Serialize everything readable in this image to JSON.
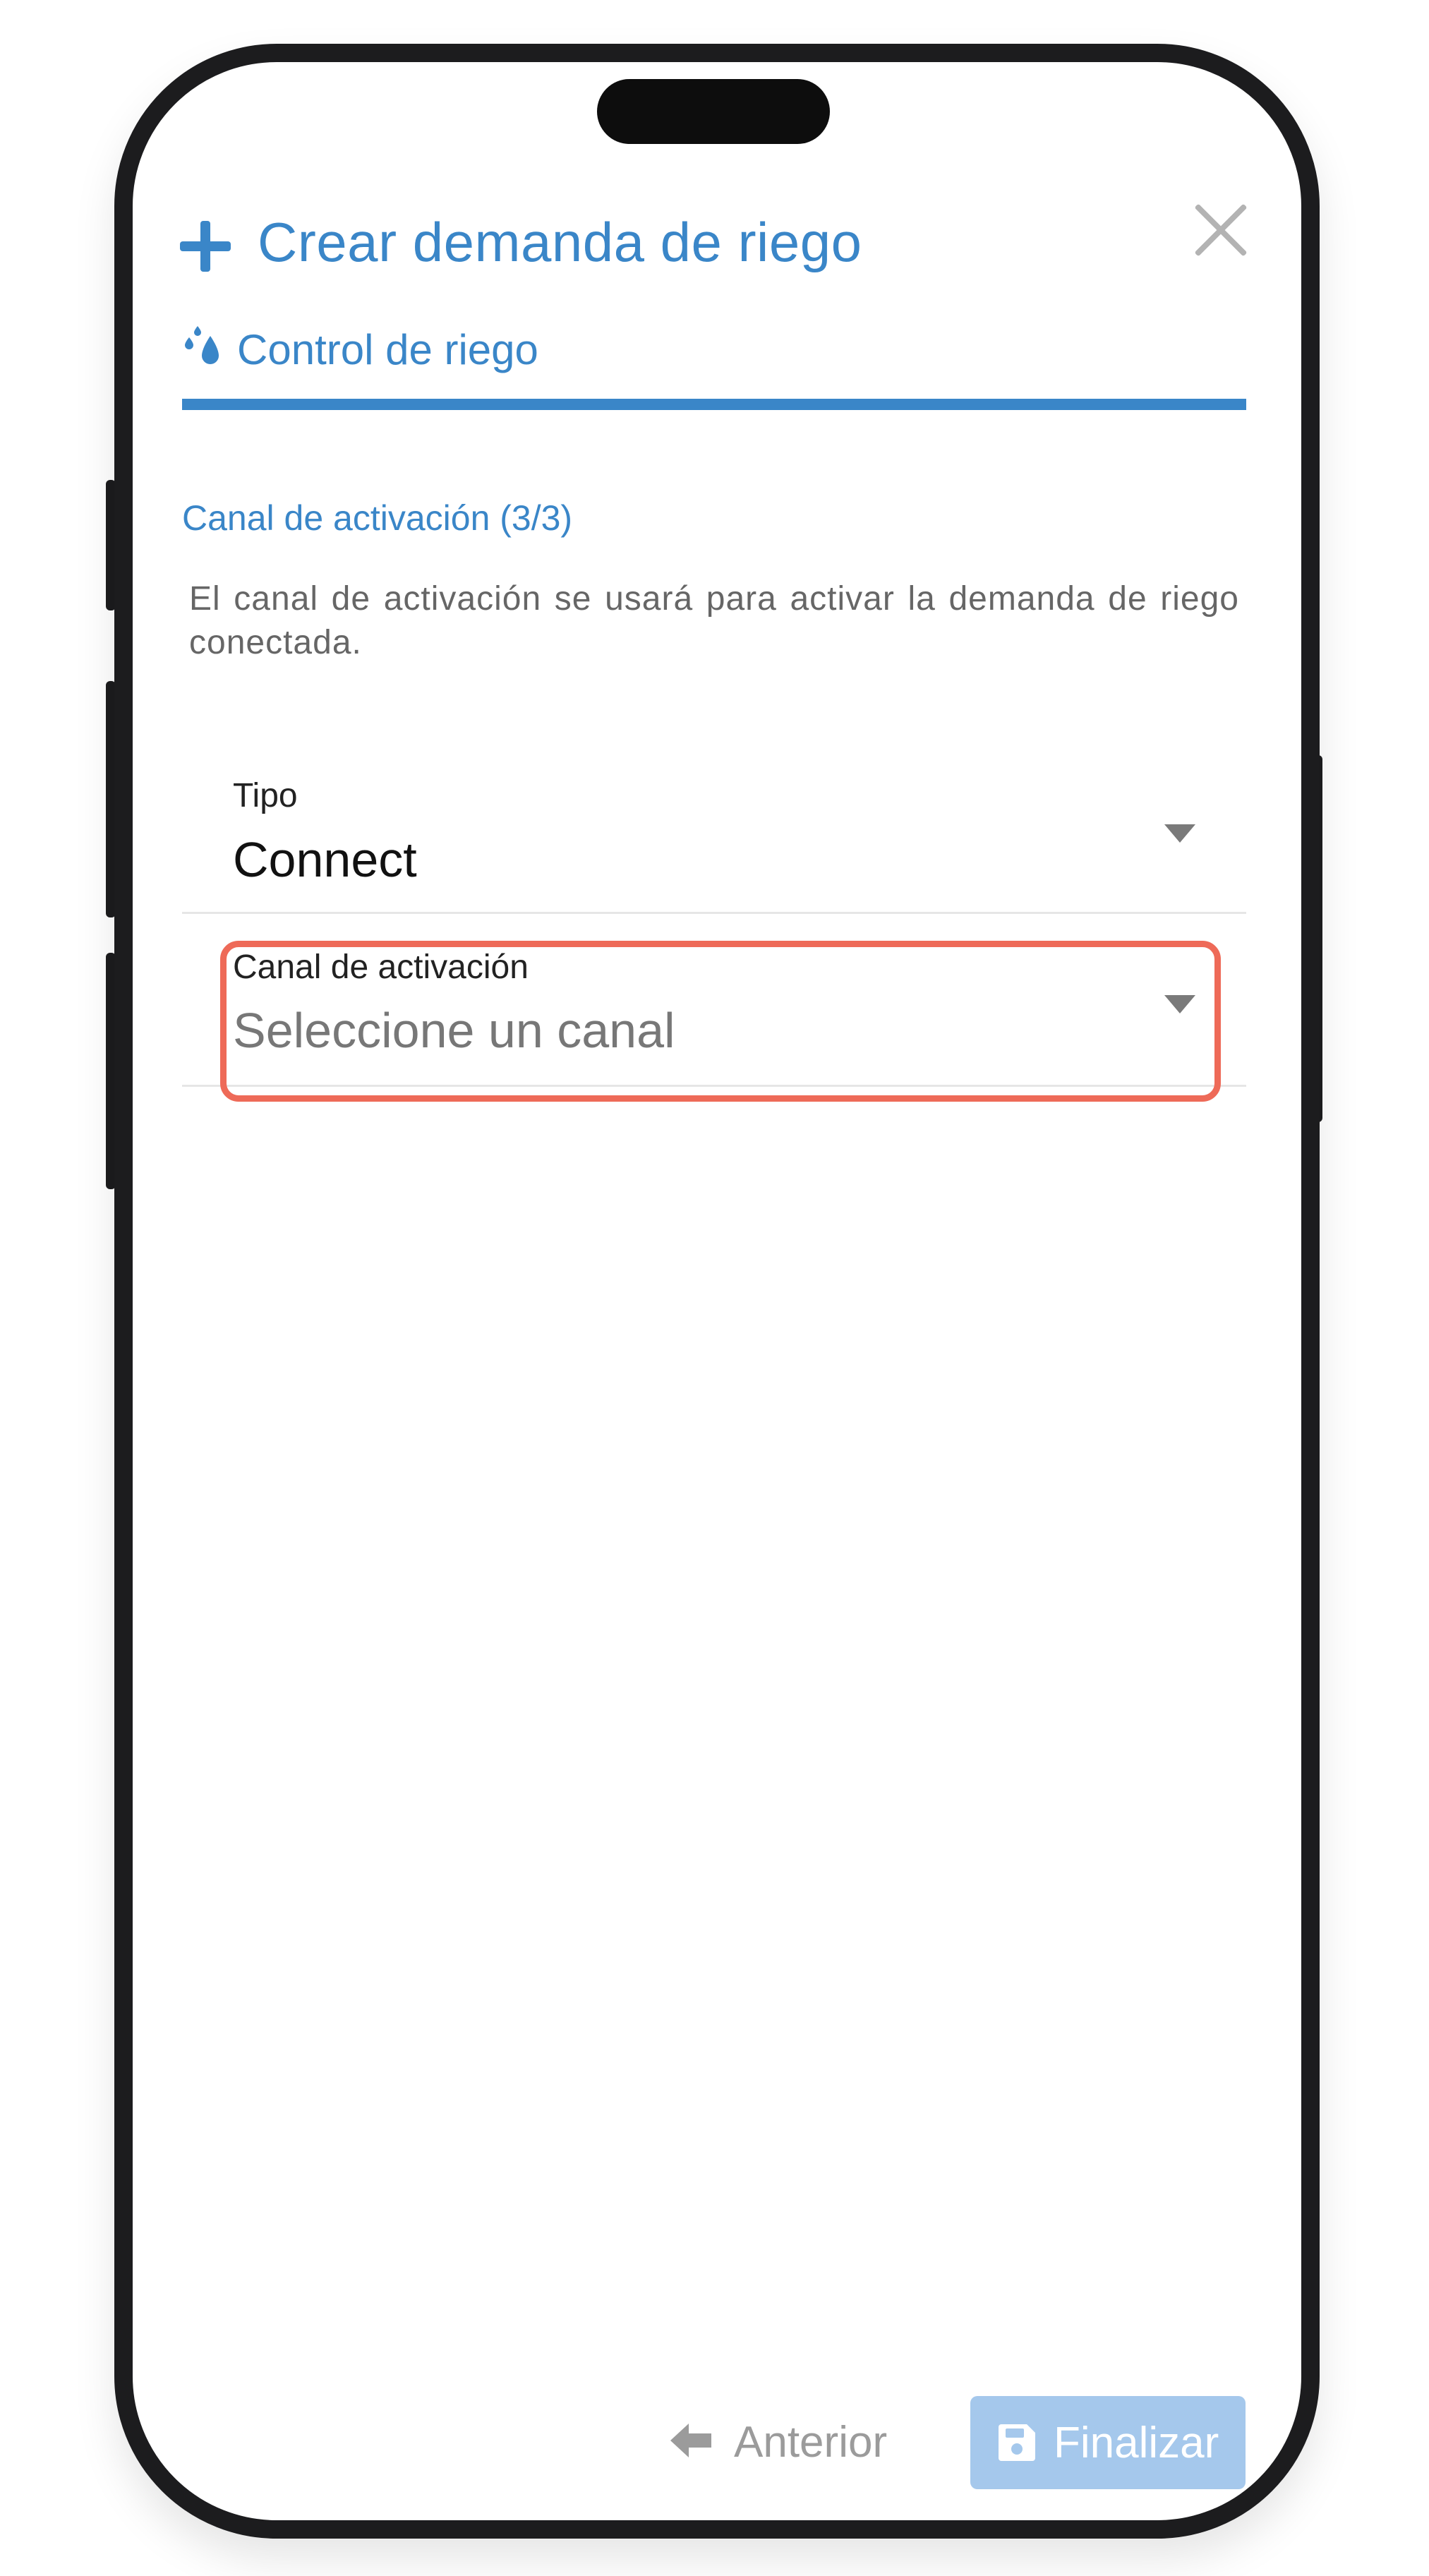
{
  "dialog": {
    "title": "Crear demanda de riego",
    "tab": {
      "label": "Control de riego"
    }
  },
  "step": {
    "title": "Canal de activación (3/3)",
    "description": "El canal de activación se usará para activar la demanda de riego conectada."
  },
  "fields": {
    "tipo": {
      "label": "Tipo",
      "value": "Connect"
    },
    "canal": {
      "label": "Canal de activación",
      "placeholder": "Seleccione un canal"
    }
  },
  "footer": {
    "previous_label": "Anterior",
    "finish_label": "Finalizar"
  },
  "colors": {
    "accent": "#3a86c8",
    "highlight": "#ee6a58",
    "finish_button": "#a5c8ec",
    "frame": "#1c1c1e"
  },
  "icons": {
    "header": "plus-icon",
    "close": "close-icon",
    "tab": "water-drops-icon",
    "dropdown": "caret-down-icon",
    "previous": "arrow-left-icon",
    "finish": "save-icon"
  }
}
